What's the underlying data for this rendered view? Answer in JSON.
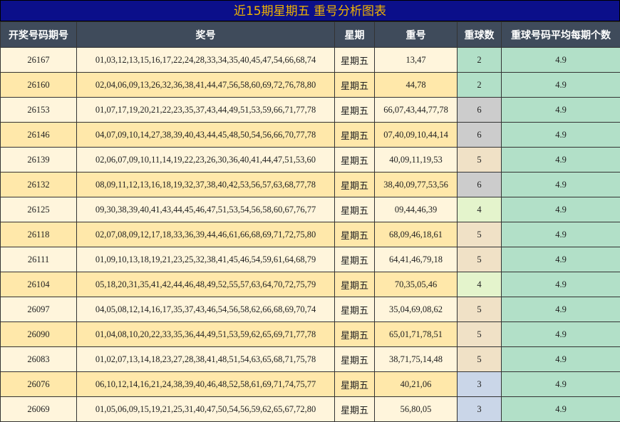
{
  "title": "近15期星期五 重号分析图表",
  "headers": [
    "开奖号码期号",
    "奖号",
    "星期",
    "重号",
    "重球数",
    "重球号码平均每期个数"
  ],
  "rows": [
    {
      "issue": "26167",
      "numbers": "01,03,12,13,15,16,17,22,24,28,33,34,35,40,45,47,54,66,68,74",
      "weekday": "星期五",
      "repeat": "13,47",
      "count": "2",
      "avg": "4.9",
      "count_color": "#b2e0c8"
    },
    {
      "issue": "26160",
      "numbers": "02,04,06,09,13,26,32,36,38,41,44,47,56,58,60,69,72,76,78,80",
      "weekday": "星期五",
      "repeat": "44,78",
      "count": "2",
      "avg": "4.9",
      "count_color": "#b2e0c8"
    },
    {
      "issue": "26153",
      "numbers": "01,07,17,19,20,21,22,23,35,37,43,44,49,51,53,59,66,71,77,78",
      "weekday": "星期五",
      "repeat": "66,07,43,44,77,78",
      "count": "6",
      "avg": "4.9",
      "count_color": "#cccccc"
    },
    {
      "issue": "26146",
      "numbers": "04,07,09,10,14,27,38,39,40,43,44,45,48,50,54,56,66,70,77,78",
      "weekday": "星期五",
      "repeat": "07,40,09,10,44,14",
      "count": "6",
      "avg": "4.9",
      "count_color": "#cccccc"
    },
    {
      "issue": "26139",
      "numbers": "02,06,07,09,10,11,14,19,22,23,26,30,36,40,41,44,47,51,53,60",
      "weekday": "星期五",
      "repeat": "40,09,11,19,53",
      "count": "5",
      "avg": "4.9",
      "count_color": "#f0e1c6"
    },
    {
      "issue": "26132",
      "numbers": "08,09,11,12,13,16,18,19,32,37,38,40,42,53,56,57,63,68,77,78",
      "weekday": "星期五",
      "repeat": "38,40,09,77,53,56",
      "count": "6",
      "avg": "4.9",
      "count_color": "#cccccc"
    },
    {
      "issue": "26125",
      "numbers": "09,30,38,39,40,41,43,44,45,46,47,51,53,54,56,58,60,67,76,77",
      "weekday": "星期五",
      "repeat": "09,44,46,39",
      "count": "4",
      "avg": "4.9",
      "count_color": "#e4f4cc"
    },
    {
      "issue": "26118",
      "numbers": "02,07,08,09,12,17,18,33,36,39,44,46,61,66,68,69,71,72,75,80",
      "weekday": "星期五",
      "repeat": "68,09,46,18,61",
      "count": "5",
      "avg": "4.9",
      "count_color": "#f0e1c6"
    },
    {
      "issue": "26111",
      "numbers": "01,09,10,13,18,19,21,23,25,32,38,41,45,46,54,59,61,64,68,79",
      "weekday": "星期五",
      "repeat": "64,41,46,79,18",
      "count": "5",
      "avg": "4.9",
      "count_color": "#f0e1c6"
    },
    {
      "issue": "26104",
      "numbers": "05,18,20,31,35,41,42,44,46,48,49,52,55,57,63,64,70,72,75,79",
      "weekday": "星期五",
      "repeat": "70,35,05,46",
      "count": "4",
      "avg": "4.9",
      "count_color": "#e4f4cc"
    },
    {
      "issue": "26097",
      "numbers": "04,05,08,12,14,16,17,35,37,43,46,54,56,58,62,66,68,69,70,74",
      "weekday": "星期五",
      "repeat": "35,04,69,08,62",
      "count": "5",
      "avg": "4.9",
      "count_color": "#f0e1c6"
    },
    {
      "issue": "26090",
      "numbers": "01,04,08,10,20,22,33,35,36,44,49,51,53,59,62,65,69,71,77,78",
      "weekday": "星期五",
      "repeat": "65,01,71,78,51",
      "count": "5",
      "avg": "4.9",
      "count_color": "#f0e1c6"
    },
    {
      "issue": "26083",
      "numbers": "01,02,07,13,14,18,23,27,28,38,41,48,51,54,63,65,68,71,75,78",
      "weekday": "星期五",
      "repeat": "38,71,75,14,48",
      "count": "5",
      "avg": "4.9",
      "count_color": "#f0e1c6"
    },
    {
      "issue": "26076",
      "numbers": "06,10,12,14,16,21,24,38,39,40,46,48,52,58,61,69,71,74,75,77",
      "weekday": "星期五",
      "repeat": "40,21,06",
      "count": "3",
      "avg": "4.9",
      "count_color": "#cad6e8"
    },
    {
      "issue": "26069",
      "numbers": "01,05,06,09,15,19,21,25,31,40,47,50,54,56,59,62,65,67,72,80",
      "weekday": "星期五",
      "repeat": "56,80,05",
      "count": "3",
      "avg": "4.9",
      "count_color": "#cad6e8"
    }
  ]
}
